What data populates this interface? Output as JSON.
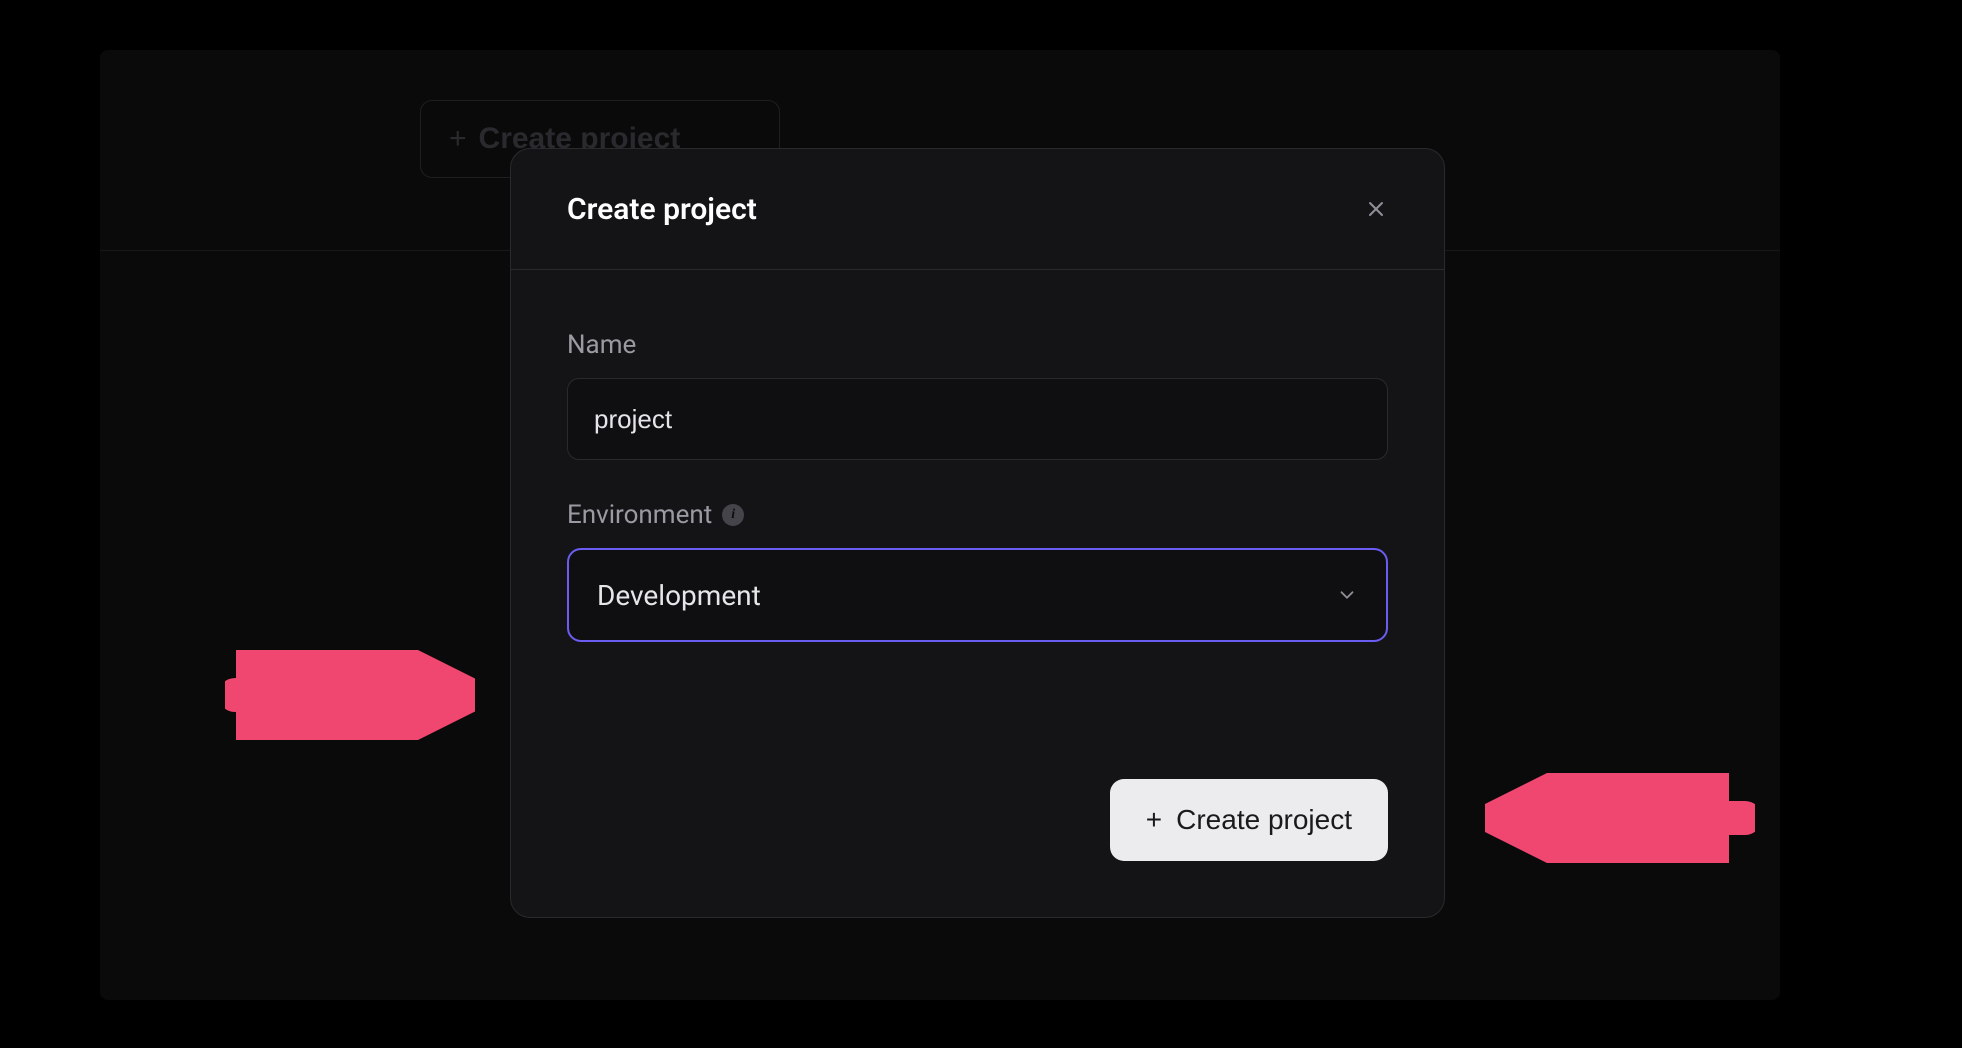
{
  "backdrop": {
    "create_button_label": "Create project"
  },
  "modal": {
    "title": "Create project",
    "close_label": "Close",
    "fields": {
      "name": {
        "label": "Name",
        "value": "project"
      },
      "environment": {
        "label": "Environment",
        "info_tooltip": "i",
        "selected": "Development"
      }
    },
    "submit_label": "Create project"
  },
  "annotations": {
    "arrow_left": "arrow pointing to Environment dropdown",
    "arrow_right": "arrow pointing to Create project button"
  },
  "colors": {
    "accent": "#6b5df1",
    "annotation": "#f04770",
    "bg": "#000000",
    "modal_bg": "#141416"
  }
}
